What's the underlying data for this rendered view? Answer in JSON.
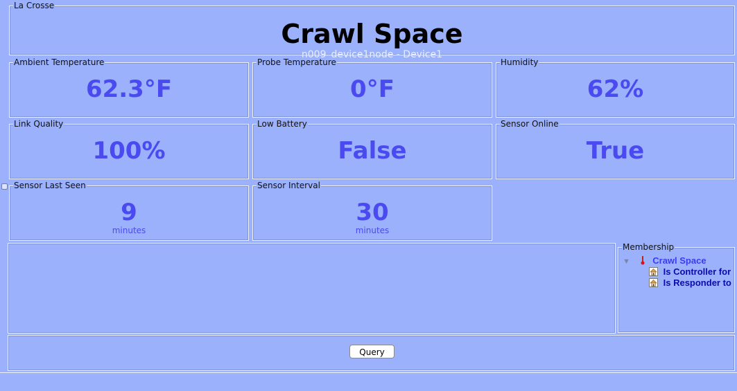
{
  "header": {
    "group_label": "La Crosse",
    "title": "Crawl Space",
    "subtitle": "n009_device1node - Device1"
  },
  "panels": [
    {
      "label": "Ambient Temperature",
      "value": "62.3°F",
      "unit": ""
    },
    {
      "label": "Probe Temperature",
      "value": "0°F",
      "unit": ""
    },
    {
      "label": "Humidity",
      "value": "62%",
      "unit": ""
    },
    {
      "label": "Link Quality",
      "value": "100%",
      "unit": ""
    },
    {
      "label": "Low Battery",
      "value": "False",
      "unit": ""
    },
    {
      "label": "Sensor Online",
      "value": "True",
      "unit": ""
    },
    {
      "label": "Sensor Last Seen",
      "value": "9",
      "unit": "minutes"
    },
    {
      "label": "Sensor Interval",
      "value": "30",
      "unit": "minutes"
    }
  ],
  "membership": {
    "label": "Membership",
    "root": "Crawl Space",
    "children": [
      "Is Controller for",
      "Is Responder to"
    ]
  },
  "actions": {
    "query_label": "Query"
  },
  "icons": {
    "thermometer": "thermometer-icon",
    "house": "house-icon",
    "expand": "triangle-down-icon"
  },
  "colors": {
    "background": "#9bb1fb",
    "value_text": "#4a4af0",
    "link_text": "#0b0ba8"
  }
}
